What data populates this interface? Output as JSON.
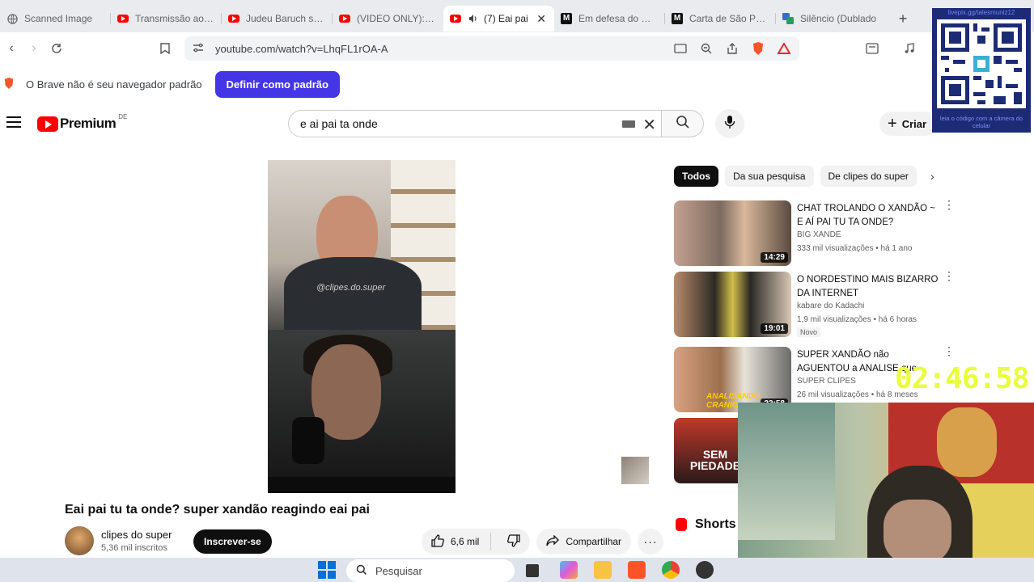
{
  "tabs": [
    {
      "title": "Scanned Image",
      "icon": "globe-icon"
    },
    {
      "title": "Transmissão ao vivo",
      "icon": "youtube-icon"
    },
    {
      "title": "Judeu Baruch sobre",
      "icon": "youtube-icon"
    },
    {
      "title": "(VIDEO ONLY): Po",
      "icon": "youtube-icon"
    },
    {
      "title": "(7) Eai pai",
      "icon": "youtube-icon",
      "active": true
    },
    {
      "title": "Em defesa do Papa",
      "icon": "medium-icon"
    },
    {
      "title": "Carta de São Paulo",
      "icon": "medium-icon"
    },
    {
      "title": "Silêncio (Dublado",
      "icon": "translate-icon"
    }
  ],
  "address": {
    "url": "youtube.com/watch?v=LhqFL1rOA-A"
  },
  "infobar": {
    "message": "O Brave não é seu navegador padrão",
    "button": "Definir como padrão"
  },
  "youtube": {
    "logo": "Premium",
    "region": "DE",
    "search_value": "e ai pai ta onde",
    "create_label": "Criar"
  },
  "video": {
    "watermark": "@clipes.do.super",
    "title": "Eai pai tu ta onde? super xandão reagindo eai pai",
    "channel": "clipes do super",
    "subscribers": "5,36 mil inscritos",
    "subscribe_label": "Inscrever-se",
    "likes": "6,6 mil",
    "share_label": "Compartilhar"
  },
  "chips": [
    "Todos",
    "Da sua pesquisa",
    "De clipes do super"
  ],
  "recommendations": [
    {
      "title": "CHAT TROLANDO O XANDÃO ~ E AÍ PAI TU TA ONDE?",
      "channel": "BIG XANDE",
      "meta": "333 mil visualizações • há 1 ano",
      "duration": "14:29",
      "badge": ""
    },
    {
      "title": "O NORDESTINO MAIS BIZARRO DA INTERNET",
      "channel": "kabare do Kadachi",
      "meta": "1,9 mil visualizações • há 6 horas",
      "duration": "19:01",
      "badge": "Novo"
    },
    {
      "title": "SUPER XANDÃO não AGUENTOU a ANALISE que",
      "channel": "SUPER CLIPES",
      "meta": "26 mil visualizações • há 8 meses",
      "duration": "23:58",
      "badge": ""
    },
    {
      "title": "",
      "channel": "",
      "meta": "",
      "duration": "",
      "badge": ""
    }
  ],
  "rec4_thumb_text": "SEM PIEDADE",
  "rec3_thumb_text": "ANALISANDO CRANIO",
  "shorts_label": "Shorts",
  "overlay": {
    "qr_link": "livepix.gg/talesmuniz12",
    "qr_caption": "leia o código com a câmera do celular",
    "clock": "02:46:58"
  },
  "taskbar": {
    "search_placeholder": "Pesquisar"
  },
  "colors": {
    "brave_button": "#4436e6",
    "youtube_red": "#ff0000",
    "clock": "#e9ff3a"
  }
}
